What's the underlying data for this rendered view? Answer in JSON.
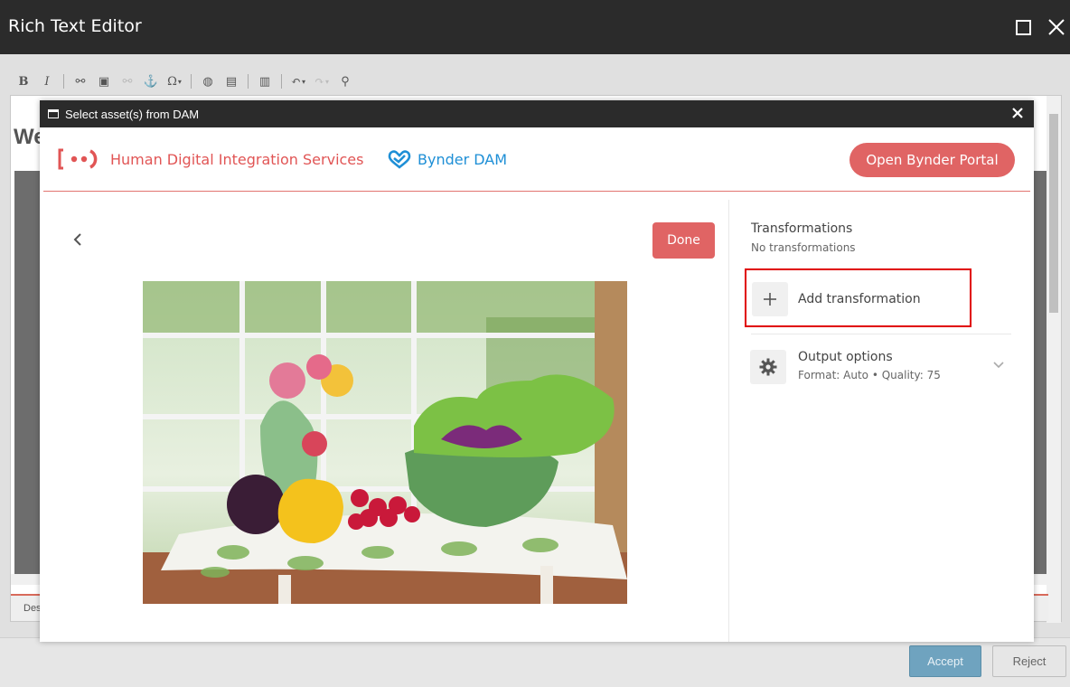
{
  "window": {
    "title": "Rich Text Editor"
  },
  "editor": {
    "heading_fragment": "We",
    "status_fragment": "Des"
  },
  "footer": {
    "accept_label": "Accept",
    "reject_label": "Reject"
  },
  "modal": {
    "title": "Select asset(s) from DAM",
    "brand_name": "Human Digital Integration Services",
    "dam_name": "Bynder DAM",
    "portal_button": "Open Bynder Portal",
    "done_button": "Done",
    "transformations": {
      "title": "Transformations",
      "subtitle": "No transformations",
      "add_label": "Add transformation"
    },
    "output_options": {
      "title": "Output options",
      "subtitle": "Format: Auto • Quality: 75"
    }
  },
  "colors": {
    "brand_red": "#e06464",
    "dam_blue": "#1e8fd6",
    "highlight_red": "#e00000",
    "title_bar": "#2b2b2b"
  },
  "icons": [
    "maximize-icon",
    "close-icon",
    "window-icon",
    "back-chevron-icon",
    "plus-icon",
    "gear-icon",
    "chevron-down-icon"
  ]
}
